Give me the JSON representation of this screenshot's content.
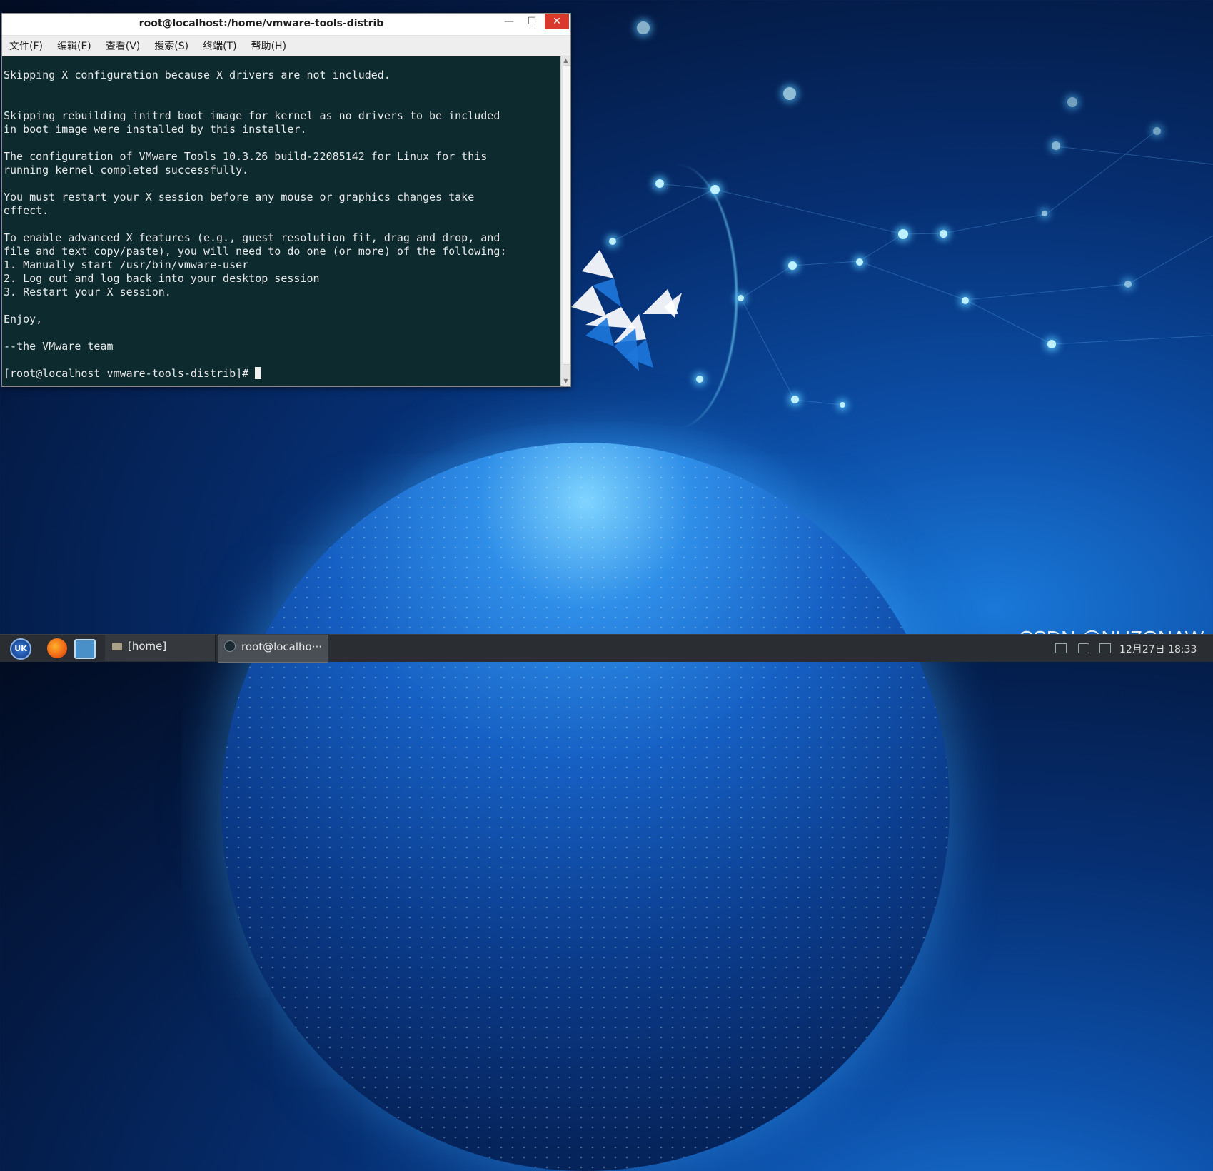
{
  "window": {
    "title": "root@localhost:/home/vmware-tools-distrib",
    "controls": {
      "minimize": "—",
      "maximize": "☐",
      "close": "✕"
    }
  },
  "menubar": {
    "items": [
      {
        "label": "文件(F)"
      },
      {
        "label": "编辑(E)"
      },
      {
        "label": "查看(V)"
      },
      {
        "label": "搜索(S)"
      },
      {
        "label": "终端(T)"
      },
      {
        "label": "帮助(H)"
      }
    ]
  },
  "terminal": {
    "output": "Skipping X configuration because X drivers are not included.\n\n\nSkipping rebuilding initrd boot image for kernel as no drivers to be included\nin boot image were installed by this installer.\n\nThe configuration of VMware Tools 10.3.26 build-22085142 for Linux for this\nrunning kernel completed successfully.\n\nYou must restart your X session before any mouse or graphics changes take\neffect.\n\nTo enable advanced X features (e.g., guest resolution fit, drag and drop, and\nfile and text copy/paste), you will need to do one (or more) of the following:\n1. Manually start /usr/bin/vmware-user\n2. Log out and log back into your desktop session\n3. Restart your X session.\n\nEnjoy,\n\n--the VMware team\n\n",
    "prompt": "[root@localhost vmware-tools-distrib]# "
  },
  "taskbar": {
    "start_label": "UK",
    "tasks": [
      {
        "label": "[home]",
        "icon": "folder-icon"
      },
      {
        "label": "root@localho···",
        "icon": "terminal-icon"
      }
    ],
    "clock": "12月27日 18:33"
  },
  "watermark": "CSDN @NUZGNAW"
}
